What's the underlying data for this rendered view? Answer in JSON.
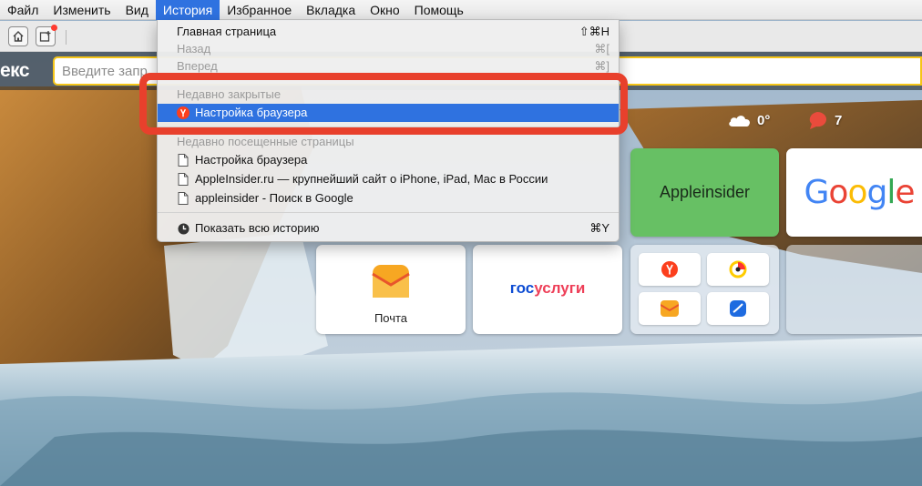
{
  "menubar": {
    "items": [
      {
        "label": "Файл",
        "active": false
      },
      {
        "label": "Изменить",
        "active": false
      },
      {
        "label": "Вид",
        "active": false
      },
      {
        "label": "История",
        "active": true
      },
      {
        "label": "Избранное",
        "active": false
      },
      {
        "label": "Вкладка",
        "active": false
      },
      {
        "label": "Окно",
        "active": false
      },
      {
        "label": "Помощь",
        "active": false
      }
    ]
  },
  "toolbar": {
    "home_icon": "home-icon",
    "new_tab_icon": "new-tab-icon"
  },
  "address_bar": {
    "brand": "екс",
    "search_placeholder": "Введите запр"
  },
  "widgets": {
    "weather": {
      "icon": "cloud-icon",
      "value": "0°"
    },
    "traffic": {
      "icon": "traffic-icon",
      "value": "7",
      "color": "#e94b3c"
    }
  },
  "history_menu": {
    "home": {
      "label": "Главная страница",
      "shortcut": "⇧⌘H"
    },
    "back": {
      "label": "Назад",
      "shortcut": "⌘["
    },
    "forward": {
      "label": "Вперед",
      "shortcut": "⌘]"
    },
    "recently_closed_header": "Недавно закрытые",
    "recently_closed": [
      {
        "label": "Настройка браузера",
        "icon": "yandex-icon"
      }
    ],
    "recently_visited_header": "Недавно посещенные страницы",
    "recently_visited": [
      {
        "label": "Настройка браузера",
        "icon": "page-icon"
      },
      {
        "label": "AppleInsider.ru — крупнейший сайт о iPhone, iPad, Mac в России",
        "icon": "page-icon"
      },
      {
        "label": "appleinsider - Поиск в Google",
        "icon": "page-icon"
      }
    ],
    "show_all": {
      "label": "Показать всю историю",
      "shortcut": "⌘Y",
      "icon": "clock-icon"
    }
  },
  "tiles": {
    "appleinsider": {
      "label": "Appleinsider",
      "color": "#67c064"
    },
    "google": {
      "letters": [
        "G",
        "o",
        "o",
        "g",
        "l",
        "e"
      ]
    },
    "pochta": {
      "label": "Почта",
      "icon": "mail-icon"
    },
    "gosuslugi": {
      "part1": "гос",
      "part2": "услуги"
    },
    "mini": [
      {
        "icon": "yandex-icon"
      },
      {
        "icon": "music-icon"
      },
      {
        "icon": "mail-icon"
      },
      {
        "icon": "zen-icon"
      }
    ]
  },
  "colors": {
    "accent": "#2f72e0",
    "highlight_frame": "#e8402c",
    "search_border": "#f5c518"
  }
}
